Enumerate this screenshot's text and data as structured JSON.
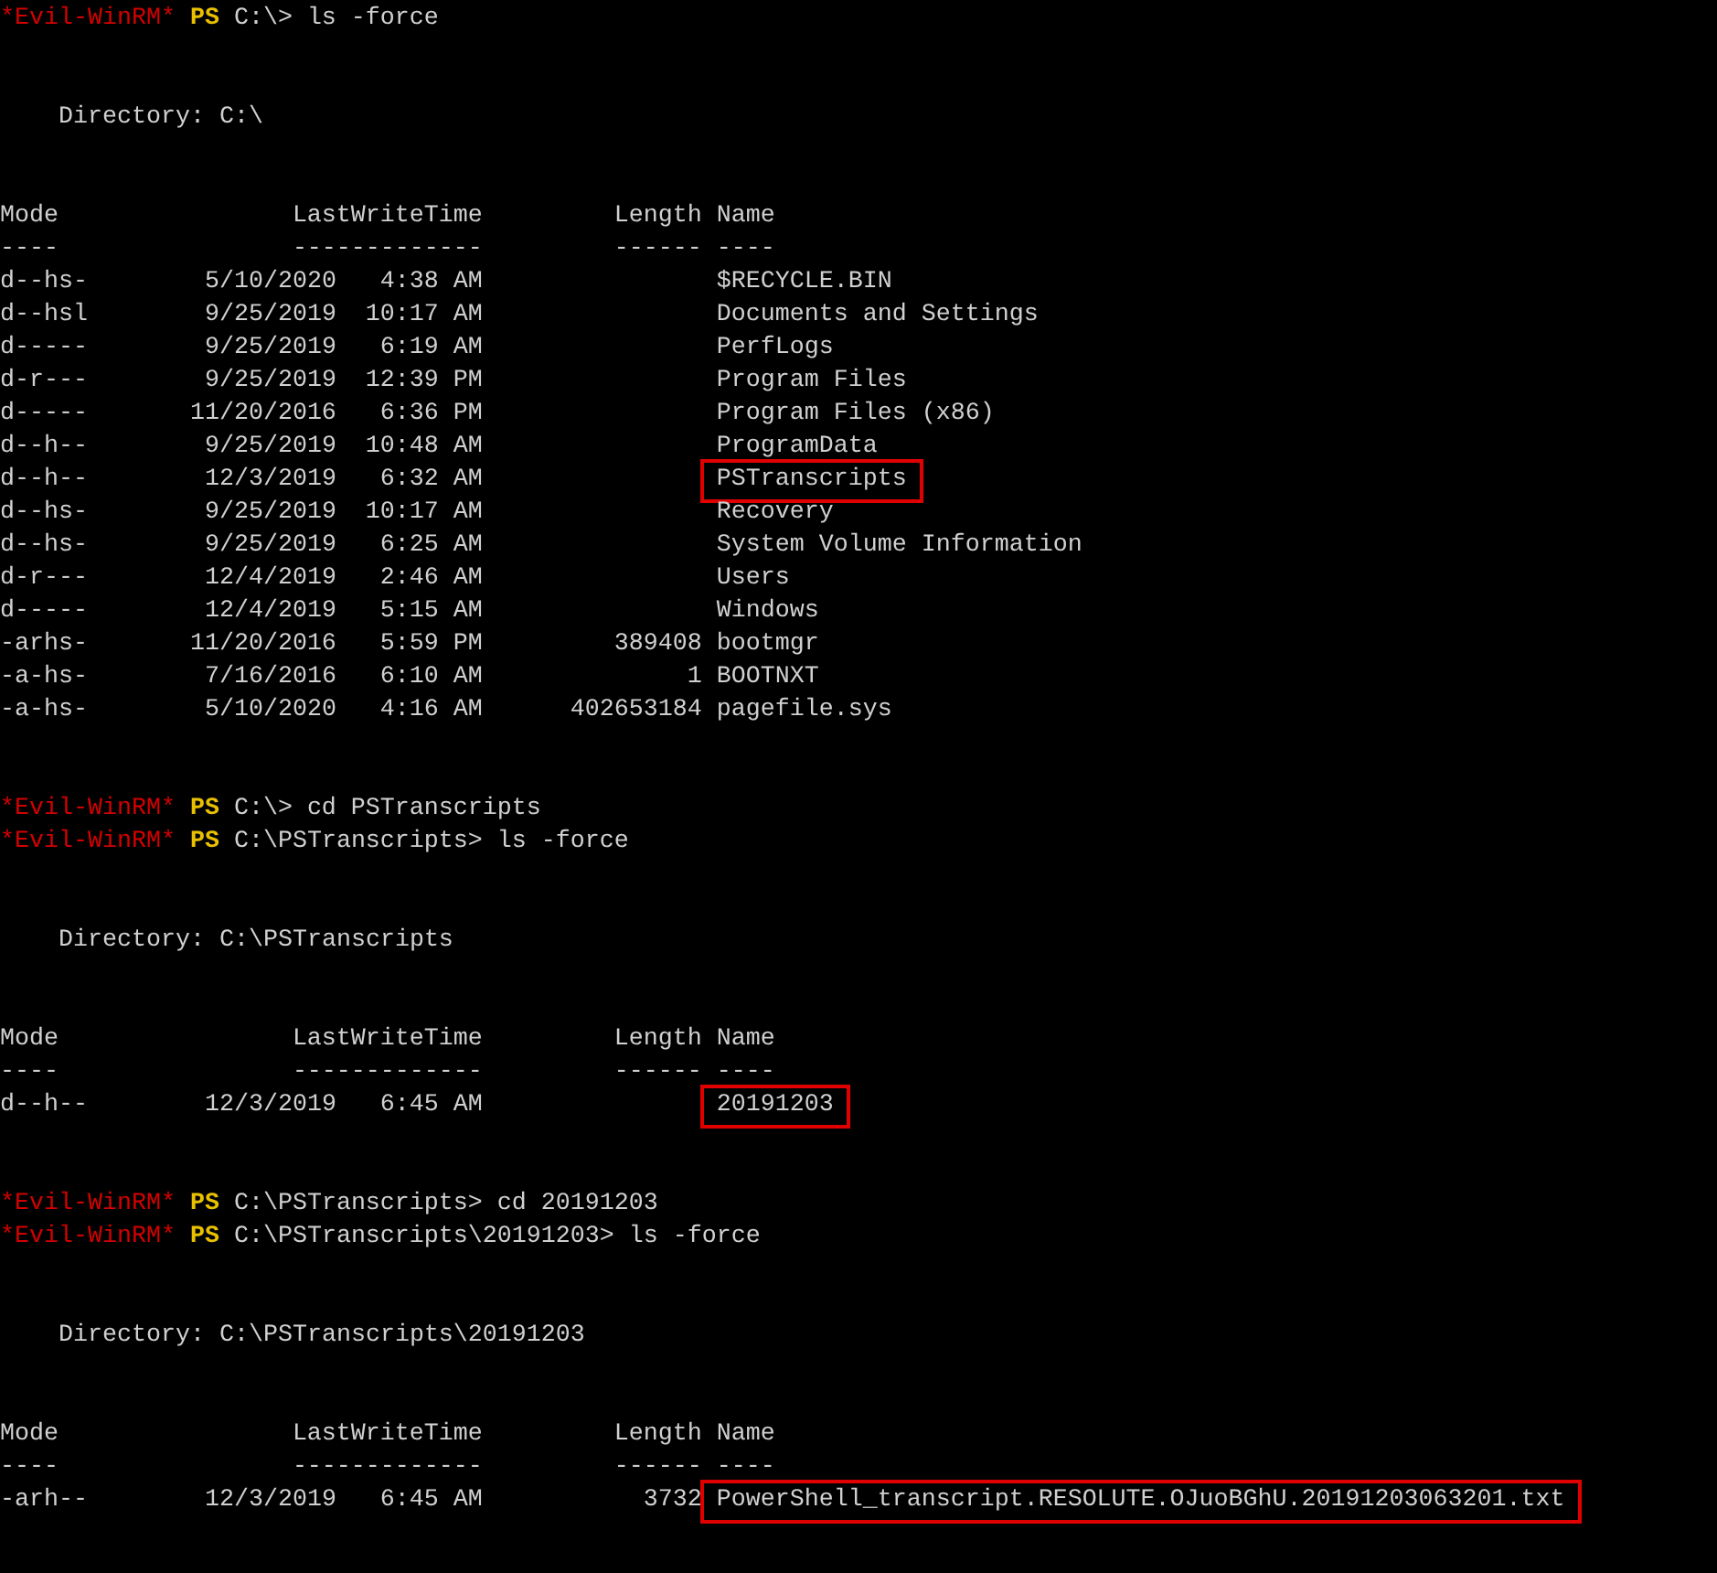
{
  "lines": [
    {
      "kind": "prompt",
      "host": "*Evil-WinRM*",
      "shell": "PS",
      "path": "C:\\>",
      "command": "ls -force"
    },
    {
      "kind": "blank"
    },
    {
      "kind": "blank"
    },
    {
      "kind": "directory",
      "text": "Directory: C:\\"
    },
    {
      "kind": "blank"
    },
    {
      "kind": "blank"
    },
    {
      "kind": "header",
      "mode": "Mode",
      "last_write_time": "LastWriteTime",
      "length": "Length",
      "name": "Name"
    },
    {
      "kind": "header",
      "mode": "----",
      "last_write_time": "-------------",
      "length": "------",
      "name": "----"
    },
    {
      "kind": "row",
      "mode": "d--hs-",
      "date": "5/10/2020",
      "time": "4:38 AM",
      "name": "$RECYCLE.BIN",
      "highlighted": false
    },
    {
      "kind": "row",
      "mode": "d--hsl",
      "date": "9/25/2019",
      "time": "10:17 AM",
      "name": "Documents and Settings",
      "highlighted": false
    },
    {
      "kind": "row",
      "mode": "d-----",
      "date": "9/25/2019",
      "time": "6:19 AM",
      "name": "PerfLogs",
      "highlighted": false
    },
    {
      "kind": "row",
      "mode": "d-r---",
      "date": "9/25/2019",
      "time": "12:39 PM",
      "name": "Program Files",
      "highlighted": false
    },
    {
      "kind": "row",
      "mode": "d-----",
      "date": "11/20/2016",
      "time": "6:36 PM",
      "name": "Program Files (x86)",
      "highlighted": false
    },
    {
      "kind": "row",
      "mode": "d--h--",
      "date": "9/25/2019",
      "time": "10:48 AM",
      "name": "ProgramData",
      "highlighted": false
    },
    {
      "kind": "row",
      "mode": "d--h--",
      "date": "12/3/2019",
      "time": "6:32 AM",
      "name": "PSTranscripts",
      "highlighted": true
    },
    {
      "kind": "row",
      "mode": "d--hs-",
      "date": "9/25/2019",
      "time": "10:17 AM",
      "name": "Recovery",
      "highlighted": false
    },
    {
      "kind": "row",
      "mode": "d--hs-",
      "date": "9/25/2019",
      "time": "6:25 AM",
      "name": "System Volume Information",
      "highlighted": false
    },
    {
      "kind": "row",
      "mode": "d-r---",
      "date": "12/4/2019",
      "time": "2:46 AM",
      "name": "Users",
      "highlighted": false
    },
    {
      "kind": "row",
      "mode": "d-----",
      "date": "12/4/2019",
      "time": "5:15 AM",
      "name": "Windows",
      "highlighted": false
    },
    {
      "kind": "row",
      "mode": "-arhs-",
      "date": "11/20/2016",
      "time": "5:59 PM",
      "length": "389408",
      "name": "bootmgr",
      "highlighted": false
    },
    {
      "kind": "row",
      "mode": "-a-hs-",
      "date": "7/16/2016",
      "time": "6:10 AM",
      "length": "1",
      "name": "BOOTNXT",
      "highlighted": false
    },
    {
      "kind": "row",
      "mode": "-a-hs-",
      "date": "5/10/2020",
      "time": "4:16 AM",
      "length": "402653184",
      "name": "pagefile.sys",
      "highlighted": false
    },
    {
      "kind": "blank"
    },
    {
      "kind": "blank"
    },
    {
      "kind": "prompt",
      "host": "*Evil-WinRM*",
      "shell": "PS",
      "path": "C:\\>",
      "command": "cd PSTranscripts"
    },
    {
      "kind": "prompt",
      "host": "*Evil-WinRM*",
      "shell": "PS",
      "path": "C:\\PSTranscripts>",
      "command": "ls -force"
    },
    {
      "kind": "blank"
    },
    {
      "kind": "blank"
    },
    {
      "kind": "directory",
      "text": "Directory: C:\\PSTranscripts"
    },
    {
      "kind": "blank"
    },
    {
      "kind": "blank"
    },
    {
      "kind": "header",
      "mode": "Mode",
      "last_write_time": "LastWriteTime",
      "length": "Length",
      "name": "Name"
    },
    {
      "kind": "header",
      "mode": "----",
      "last_write_time": "-------------",
      "length": "------",
      "name": "----"
    },
    {
      "kind": "row",
      "mode": "d--h--",
      "date": "12/3/2019",
      "time": "6:45 AM",
      "name": "20191203",
      "highlighted": true
    },
    {
      "kind": "blank"
    },
    {
      "kind": "blank"
    },
    {
      "kind": "prompt",
      "host": "*Evil-WinRM*",
      "shell": "PS",
      "path": "C:\\PSTranscripts>",
      "command": "cd 20191203"
    },
    {
      "kind": "prompt",
      "host": "*Evil-WinRM*",
      "shell": "PS",
      "path": "C:\\PSTranscripts\\20191203>",
      "command": "ls -force"
    },
    {
      "kind": "blank"
    },
    {
      "kind": "blank"
    },
    {
      "kind": "directory",
      "text": "Directory: C:\\PSTranscripts\\20191203"
    },
    {
      "kind": "blank"
    },
    {
      "kind": "blank"
    },
    {
      "kind": "header",
      "mode": "Mode",
      "last_write_time": "LastWriteTime",
      "length": "Length",
      "name": "Name"
    },
    {
      "kind": "header",
      "mode": "----",
      "last_write_time": "-------------",
      "length": "------",
      "name": "----"
    },
    {
      "kind": "row",
      "mode": "-arh--",
      "date": "12/3/2019",
      "time": "6:45 AM",
      "length": "3732",
      "name": "PowerShell_transcript.RESOLUTE.OJuoBGhU.20191203063201.txt",
      "highlighted": true
    }
  ]
}
